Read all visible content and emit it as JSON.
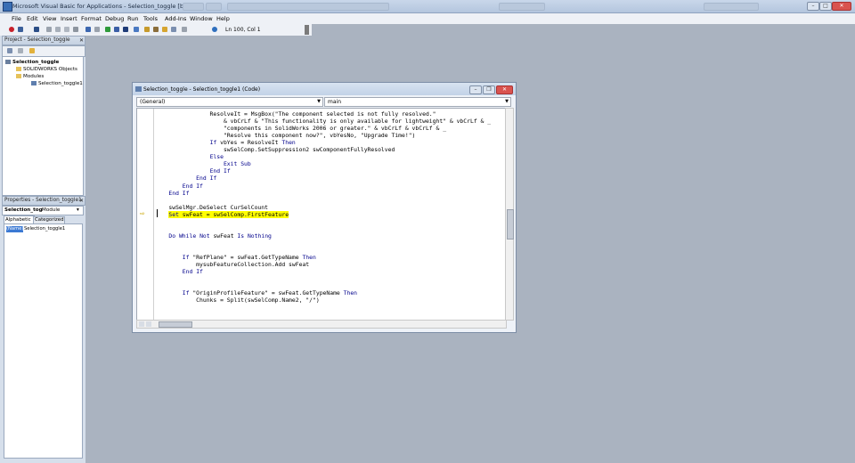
{
  "window": {
    "title": "Microsoft Visual Basic for Applications - Selection_toggle [break]"
  },
  "menu": [
    "File",
    "Edit",
    "View",
    "Insert",
    "Format",
    "Debug",
    "Run",
    "Tools",
    "Add-Ins",
    "Window",
    "Help"
  ],
  "toolbar": {
    "position": "Ln 100, Col 1"
  },
  "project": {
    "header": "Project - Selection_toggle",
    "root": "Selection_toggle",
    "folder1": "SOLIDWORKS Objects",
    "folder2": "Modules",
    "module": "Selection_toggle1"
  },
  "properties": {
    "header": "Properties - Selection_toggle1",
    "object_name": "Selection_tog",
    "object_type": "Module",
    "tab_alphabetic": "Alphabetic",
    "tab_categorized": "Categorized",
    "prop_name": "(Name)",
    "prop_value": "Selection_toggle1"
  },
  "codewin": {
    "title": "Selection_toggle - Selection_toggle1 (Code)",
    "object_combo": "(General)",
    "proc_combo": "main",
    "lines": [
      "                ResolveIt = MsgBox(\"The component selected is not fully resolved.\"",
      "                    & vbCrLf & \"This functionality is only available for lightweight\" & vbCrLf & _",
      "                    \"components in SolidWorks 2006 or greater.\" & vbCrLf & vbCrLf & _",
      "                    \"Resolve this component now?\", vbYesNo, \"Upgrade Time!\")",
      "                If vbYes = ResolveIt Then",
      "                    swSelComp.SetSuppression2 swComponentFullyResolved",
      "                Else",
      "                    Exit Sub",
      "                End If",
      "            End If",
      "        End If",
      "    End If",
      "",
      "    swSelMgr.DeSelect CurSelCount",
      "    Set swFeat = swSelComp.FirstFeature",
      "",
      "",
      "    Do While Not swFeat Is Nothing",
      "",
      "",
      "        If \"RefPlane\" = swFeat.GetTypeName Then",
      "            mysubFeatureCollection.Add swFeat",
      "        End If",
      "",
      "",
      "        If \"OriginProfileFeature\" = swFeat.GetTypeName Then",
      "            Chunks = Split(swSelComp.Name2, \"/\")"
    ]
  },
  "colors": {
    "highlight": "#ffff00",
    "keyword": "#00008b",
    "background": "#aab3c0"
  }
}
